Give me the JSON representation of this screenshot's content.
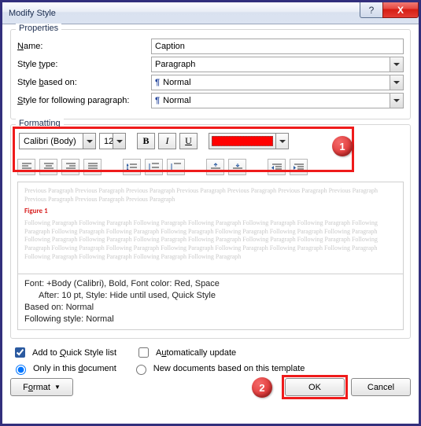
{
  "window": {
    "title": "Modify Style",
    "help": "?",
    "close": "X"
  },
  "properties": {
    "group_label": "Properties",
    "name_label": "Name:",
    "name_value": "Caption",
    "type_label": "Style type:",
    "type_value": "Paragraph",
    "based_label": "Style based on:",
    "based_value": "Normal",
    "following_label": "Style for following paragraph:",
    "following_value": "Normal"
  },
  "formatting": {
    "group_label": "Formatting",
    "font_name": "Calibri (Body)",
    "font_size": "12",
    "bold": "B",
    "italic": "I",
    "underline": "U",
    "color": "#ff0000"
  },
  "preview": {
    "prev_text": "Previous Paragraph Previous Paragraph Previous Paragraph Previous Paragraph Previous Paragraph Previous Paragraph Previous Paragraph Previous Paragraph Previous Paragraph Previous Paragraph",
    "sample": "Figure 1",
    "follow_text": "Following Paragraph Following Paragraph Following Paragraph Following Paragraph Following Paragraph Following Paragraph Following Paragraph Following Paragraph Following Paragraph Following Paragraph Following Paragraph Following Paragraph Following Paragraph Following Paragraph Following Paragraph Following Paragraph Following Paragraph Following Paragraph Following Paragraph Following Paragraph Following Paragraph Following Paragraph Following Paragraph Following Paragraph Following Paragraph Following Paragraph Following Paragraph Following Paragraph Following Paragraph Following Paragraph"
  },
  "description": {
    "line1": "Font: +Body (Calibri), Bold, Font color: Red, Space",
    "line2": "After:  10 pt, Style: Hide until used, Quick Style",
    "line3": "Based on: Normal",
    "line4": "Following style: Normal"
  },
  "options": {
    "add_quick": "Add to Quick Style list",
    "auto_update": "Automatically update",
    "only_doc": "Only in this document",
    "new_template": "New documents based on this template"
  },
  "footer": {
    "format": "Format",
    "ok": "OK",
    "cancel": "Cancel"
  },
  "callouts": {
    "one": "1",
    "two": "2"
  }
}
